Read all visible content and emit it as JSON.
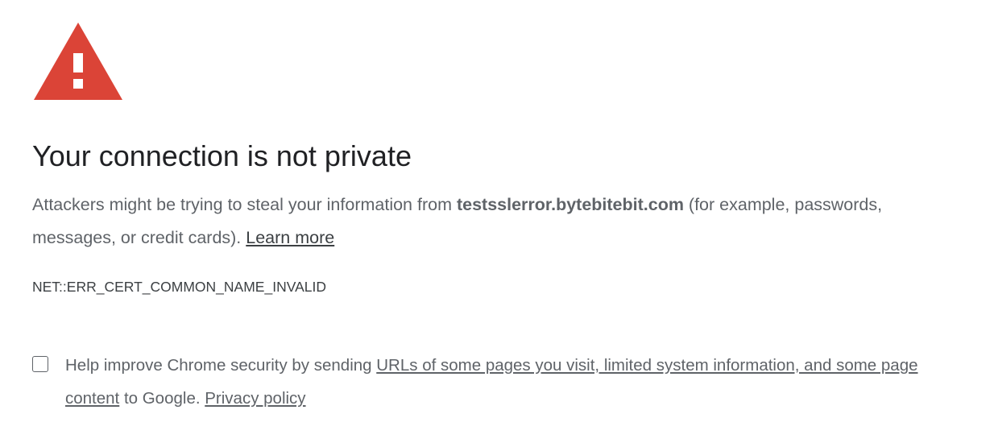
{
  "icons": {
    "warning": "warning-triangle-icon",
    "warning_color": "#db4437"
  },
  "heading": {
    "title": "Your connection is not private"
  },
  "description": {
    "before_host": "Attackers might be trying to steal your information from ",
    "host": "testsslerror.bytebitebit.com",
    "after_host": " (for example, passwords, messages, or credit cards). ",
    "learn_more": "Learn more"
  },
  "error_code": "NET::ERR_CERT_COMMON_NAME_INVALID",
  "optin": {
    "checked": false,
    "before_link": "Help improve Chrome security by sending ",
    "link_text": "URLs of some pages you visit, limited system information, and some page content",
    "middle": " to Google. ",
    "privacy_link": "Privacy policy"
  }
}
